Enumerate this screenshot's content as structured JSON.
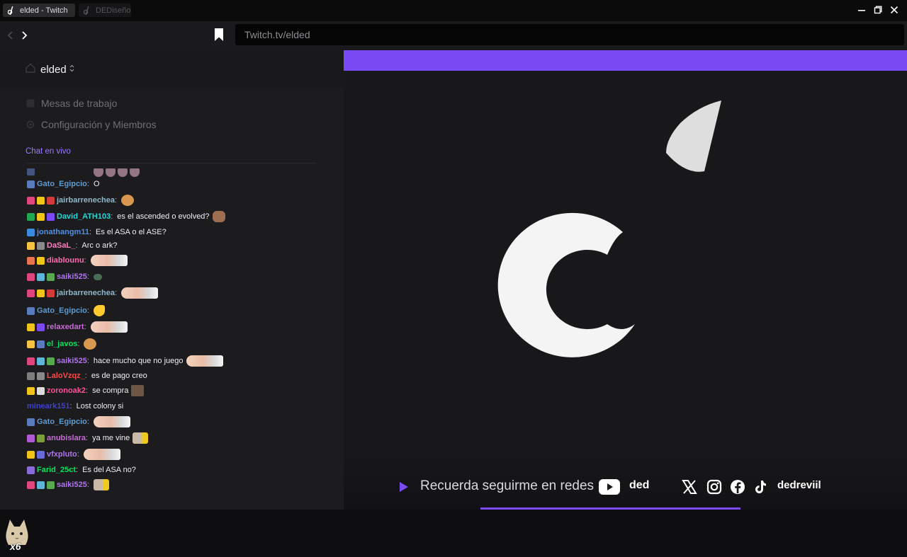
{
  "browser": {
    "tabs": [
      {
        "label": "elded - Twitch",
        "active": true
      },
      {
        "label": "DEDiseño",
        "active": false
      }
    ],
    "url": "Twitch.tv/elded"
  },
  "sidebar": {
    "workspace_name": "elded",
    "menu": [
      {
        "label": "Mesas de trabajo",
        "icon": "grid-icon"
      },
      {
        "label": "Configuración y Miembros",
        "icon": "settings-icon"
      }
    ],
    "chat_label": "Chat en vivo"
  },
  "chat": {
    "messages": [
      {
        "user": "Gato_Egipcio",
        "color": "#5b9bd5",
        "badges": [
          "#5b7bbf"
        ],
        "text": "O",
        "emotes": []
      },
      {
        "user": "jairbarrenechea",
        "color": "#8fb7c9",
        "badges": [
          "#e0457b",
          "#f0c419",
          "#d43c3c"
        ],
        "text": "",
        "emotes": [
          "small"
        ]
      },
      {
        "user": "David_ATH103",
        "color": "#21d8d8",
        "badges": [
          "#1fa84f",
          "#f0c419",
          "#7a4af5"
        ],
        "text": "es el ascended o evolved?",
        "emotes": [
          "brown"
        ]
      },
      {
        "user": "jonathangm11",
        "color": "#4f8fe6",
        "badges": [
          "#3a8dde"
        ],
        "text": "Es el ASA o el ASE?",
        "emotes": []
      },
      {
        "user": "DaSaL_",
        "color": "#ff7fbf",
        "badges": [
          "#f5c443",
          "#8a8a8a"
        ],
        "text": "Arc o ark?",
        "emotes": []
      },
      {
        "user": "diablounu",
        "color": "#ff69b4",
        "badges": [
          "#e8744f",
          "#f0c419"
        ],
        "text": "",
        "emotes": [
          "cat"
        ]
      },
      {
        "user": "saiki525",
        "color": "#b072f2",
        "badges": [
          "#e0457b",
          "#5fb4d9",
          "#58a84f"
        ],
        "text": "",
        "emotes": [
          "green"
        ]
      },
      {
        "user": "jairbarrenechea",
        "color": "#8fb7c9",
        "badges": [
          "#e0457b",
          "#f0c419",
          "#d43c3c"
        ],
        "text": "",
        "emotes": [
          "cat"
        ]
      },
      {
        "user": "Gato_Egipcio",
        "color": "#5b9bd5",
        "badges": [
          "#5b7bbf"
        ],
        "text": "",
        "emotes": [
          "yellow"
        ]
      },
      {
        "user": "relaxedart",
        "color": "#c86bd8",
        "badges": [
          "#f0c419",
          "#7a4af5"
        ],
        "text": "",
        "emotes": [
          "cat"
        ]
      },
      {
        "user": "el_javos",
        "color": "#00e65c",
        "badges": [
          "#f5c443",
          "#5b7bbf"
        ],
        "text": "",
        "emotes": [
          "small"
        ]
      },
      {
        "user": "saiki525",
        "color": "#b072f2",
        "badges": [
          "#e0457b",
          "#5fb4d9",
          "#58a84f"
        ],
        "text": "hace mucho que no juego",
        "emotes": [
          "cat"
        ]
      },
      {
        "user": "LaloVzqz_",
        "color": "#ff4747",
        "badges": [
          "#7d7d7d",
          "#8a8a8a"
        ],
        "text": "es de pago creo",
        "emotes": []
      },
      {
        "user": "zoronoak2",
        "color": "#ff4f9b",
        "badges": [
          "#f0c419",
          "#dcdcdc"
        ],
        "text": "se compra",
        "emotes": [
          "box"
        ]
      },
      {
        "user": "mineark151",
        "color": "#3f3fd1",
        "badges": [],
        "text": "Lost colony si",
        "emotes": []
      },
      {
        "user": "Gato_Egipcio",
        "color": "#5b9bd5",
        "badges": [
          "#5b7bbf"
        ],
        "text": "",
        "emotes": [
          "cat"
        ]
      },
      {
        "user": "anubislara",
        "color": "#c86bd8",
        "badges": [
          "#b05ad8",
          "#7a9f3a"
        ],
        "text": "ya me vine",
        "emotes": [
          "hat"
        ]
      },
      {
        "user": "vfxpluto",
        "color": "#b072f2",
        "badges": [
          "#f0c419",
          "#6a6ad8"
        ],
        "text": "",
        "emotes": [
          "cat"
        ]
      },
      {
        "user": "Farid_25ct",
        "color": "#00e65c",
        "badges": [
          "#8a6ad8"
        ],
        "text": "Es del ASA no?",
        "emotes": []
      },
      {
        "user": "saiki525",
        "color": "#b072f2",
        "badges": [
          "#e0457b",
          "#5fb4d9",
          "#58a84f"
        ],
        "text": "",
        "emotes": [
          "hat"
        ]
      }
    ],
    "overlay_badge": "x6"
  },
  "stream": {
    "accent_color": "#7a4af5",
    "bottom_text": "Recuerda seguirme en redes",
    "youtube_handle": "ded",
    "social_handle": "dedreviil",
    "social_icons": [
      "x-icon",
      "instagram-icon",
      "facebook-icon",
      "tiktok-icon"
    ]
  }
}
